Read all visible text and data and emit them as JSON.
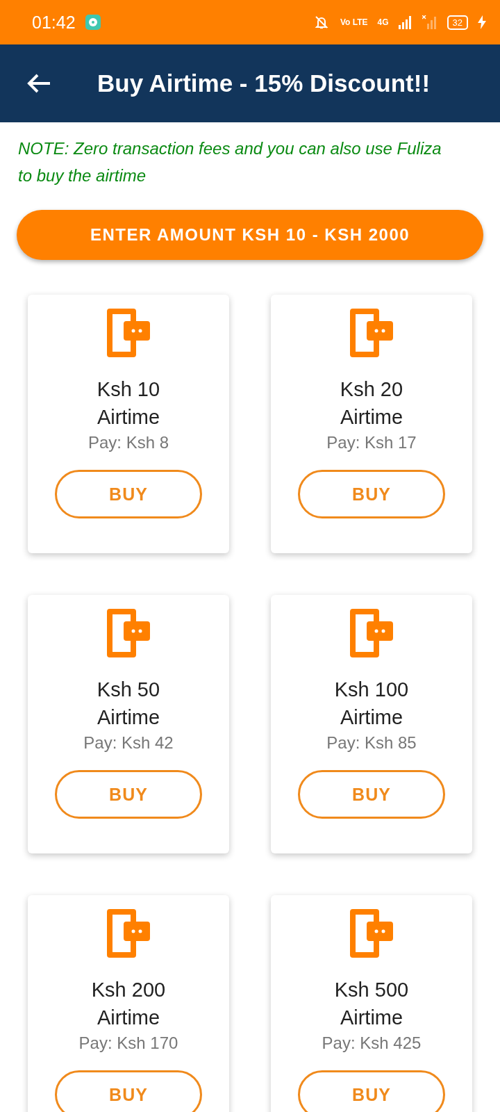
{
  "status_bar": {
    "time": "01:42",
    "volte": "Vo LTE",
    "network": "4G",
    "battery": "32"
  },
  "header": {
    "title": "Buy Airtime - 15% Discount!!"
  },
  "note": "NOTE: Zero transaction fees and you can also use Fuliza to buy the airtime",
  "amount_button": "ENTER AMOUNT KSH 10 - KSH 2000",
  "products": [
    {
      "title": "Ksh 10",
      "subtitle": "Airtime",
      "pay": "Pay: Ksh 8",
      "button": "BUY"
    },
    {
      "title": "Ksh 20",
      "subtitle": "Airtime",
      "pay": "Pay: Ksh 17",
      "button": "BUY"
    },
    {
      "title": "Ksh 50",
      "subtitle": "Airtime",
      "pay": "Pay: Ksh 42",
      "button": "BUY"
    },
    {
      "title": "Ksh 100",
      "subtitle": "Airtime",
      "pay": "Pay: Ksh 85",
      "button": "BUY"
    },
    {
      "title": "Ksh 200",
      "subtitle": "Airtime",
      "pay": "Pay: Ksh 170",
      "button": "BUY"
    },
    {
      "title": "Ksh 500",
      "subtitle": "Airtime",
      "pay": "Pay: Ksh 425",
      "button": "BUY"
    }
  ]
}
